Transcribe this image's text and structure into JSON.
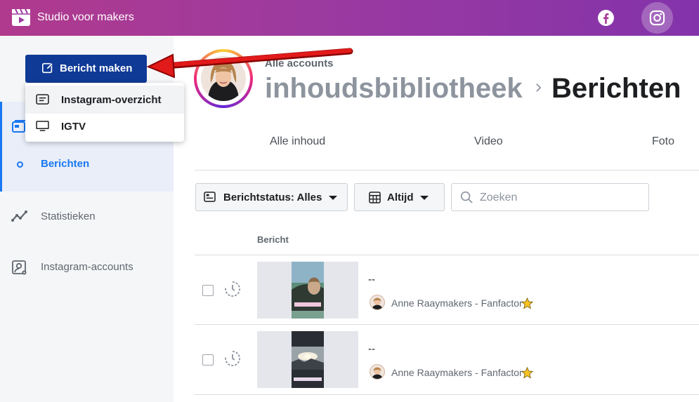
{
  "app": {
    "title": "Studio voor makers"
  },
  "topbar": {
    "facebook_icon": "facebook-icon",
    "instagram_icon": "instagram-icon"
  },
  "sidebar": {
    "create_button": "Bericht maken",
    "items": [
      {
        "label": "Berichten",
        "icon": "circle-icon",
        "active": true
      },
      {
        "label": "Statistieken",
        "icon": "chart-line-icon"
      },
      {
        "label": "Instagram-accounts",
        "icon": "account-settings-icon"
      }
    ]
  },
  "dropdown": {
    "items": [
      {
        "label": "Instagram-overzicht",
        "icon": "feed-icon"
      },
      {
        "label": "IGTV",
        "icon": "tv-icon"
      }
    ]
  },
  "header": {
    "subheading": "Alle accounts",
    "breadcrumb": "inhoudsbibliotheek",
    "title": "Berichten"
  },
  "tabs": [
    "Alle inhoud",
    "Video",
    "Foto"
  ],
  "filters": {
    "status_label": "Berichtstatus:",
    "status_value": "Alles",
    "time_label": "Altijd",
    "search_placeholder": "Zoeken"
  },
  "table": {
    "column_header": "Bericht",
    "rows": [
      {
        "title": "--",
        "account": "Anne Raaymakers - Fanfactor"
      },
      {
        "title": "--",
        "account": "Anne Raaymakers - Fanfactor"
      }
    ]
  },
  "colors": {
    "accent": "#1877f2",
    "create_button": "#0f3a96",
    "topbar_start": "#b03a8d",
    "topbar_end": "#8333aa",
    "arrow": "#e21a1a"
  }
}
